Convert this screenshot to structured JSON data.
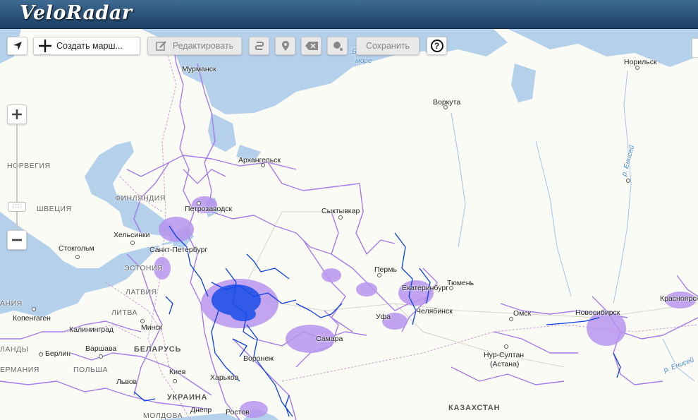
{
  "app": {
    "title": "VeloRadar"
  },
  "toolbar": {
    "create_route_label": "Создать марш...",
    "edit_label": "Редактировать",
    "save_label": "Сохранить",
    "help_label": "?"
  },
  "map": {
    "labels": {
      "norway": "НОРВЕГИЯ",
      "sweden": "ШВЕЦИЯ",
      "finland": "ФИНЛЯНДИЯ",
      "estonia": "ЭСТОНИЯ",
      "latvia": "ЛАТВИЯ",
      "lithuania": "ЛИТВА",
      "belarus": "БЕЛАРУСЬ",
      "poland": "ПОЛЬША",
      "germany": "ЕРМАНИЯ",
      "denmark": "АНИЯ",
      "ukraine": "УКРАИНА",
      "moldova": "МОЛДОВА",
      "kazakhstan": "КАЗАХСТАН",
      "holland": "ЛАНДЫ",
      "murmansk": "Мурманск",
      "arkhangelsk": "Архангельск",
      "vorkuta": "Воркута",
      "norilsk": "Норильск",
      "syktyvkar": "Сыктывкар",
      "petrozavodsk": "Петрозаводск",
      "helsinki": "Хельсинки",
      "stockholm": "Стокгольм",
      "st_petersburg": "Санкт-Петербург",
      "copenhagen": "Копенгаген",
      "kaliningrad": "Калининград",
      "minsk": "Минск",
      "berlin": "Берлин",
      "warsaw": "Варшава",
      "kiev": "Киев",
      "lviv": "Львов",
      "kharkiv": "Харьков",
      "dnepr": "Днепр",
      "rostov": "Ростов",
      "voronezh": "Воронеж",
      "samara": "Самара",
      "ufa": "Уфа",
      "perm": "Пермь",
      "yekaterinburg": "Екатеринбург",
      "chelyabinsk": "Челябинск",
      "tyumen": "Тюмень",
      "omsk": "Омск",
      "novosibirsk": "Новосибирск",
      "krasnoyarsk": "Красноярск",
      "nursultan": "Нур-Султан",
      "astana": "(Астана)",
      "sea": "море",
      "sea2": "Ба",
      "yenisei1": "р. Енисей",
      "yenisei2": "р. Енисей"
    }
  },
  "colors": {
    "route_purple": "#a47be8",
    "route_blue": "#0a3fe0",
    "water": "#b5d0ea",
    "header": "#2b5178"
  }
}
